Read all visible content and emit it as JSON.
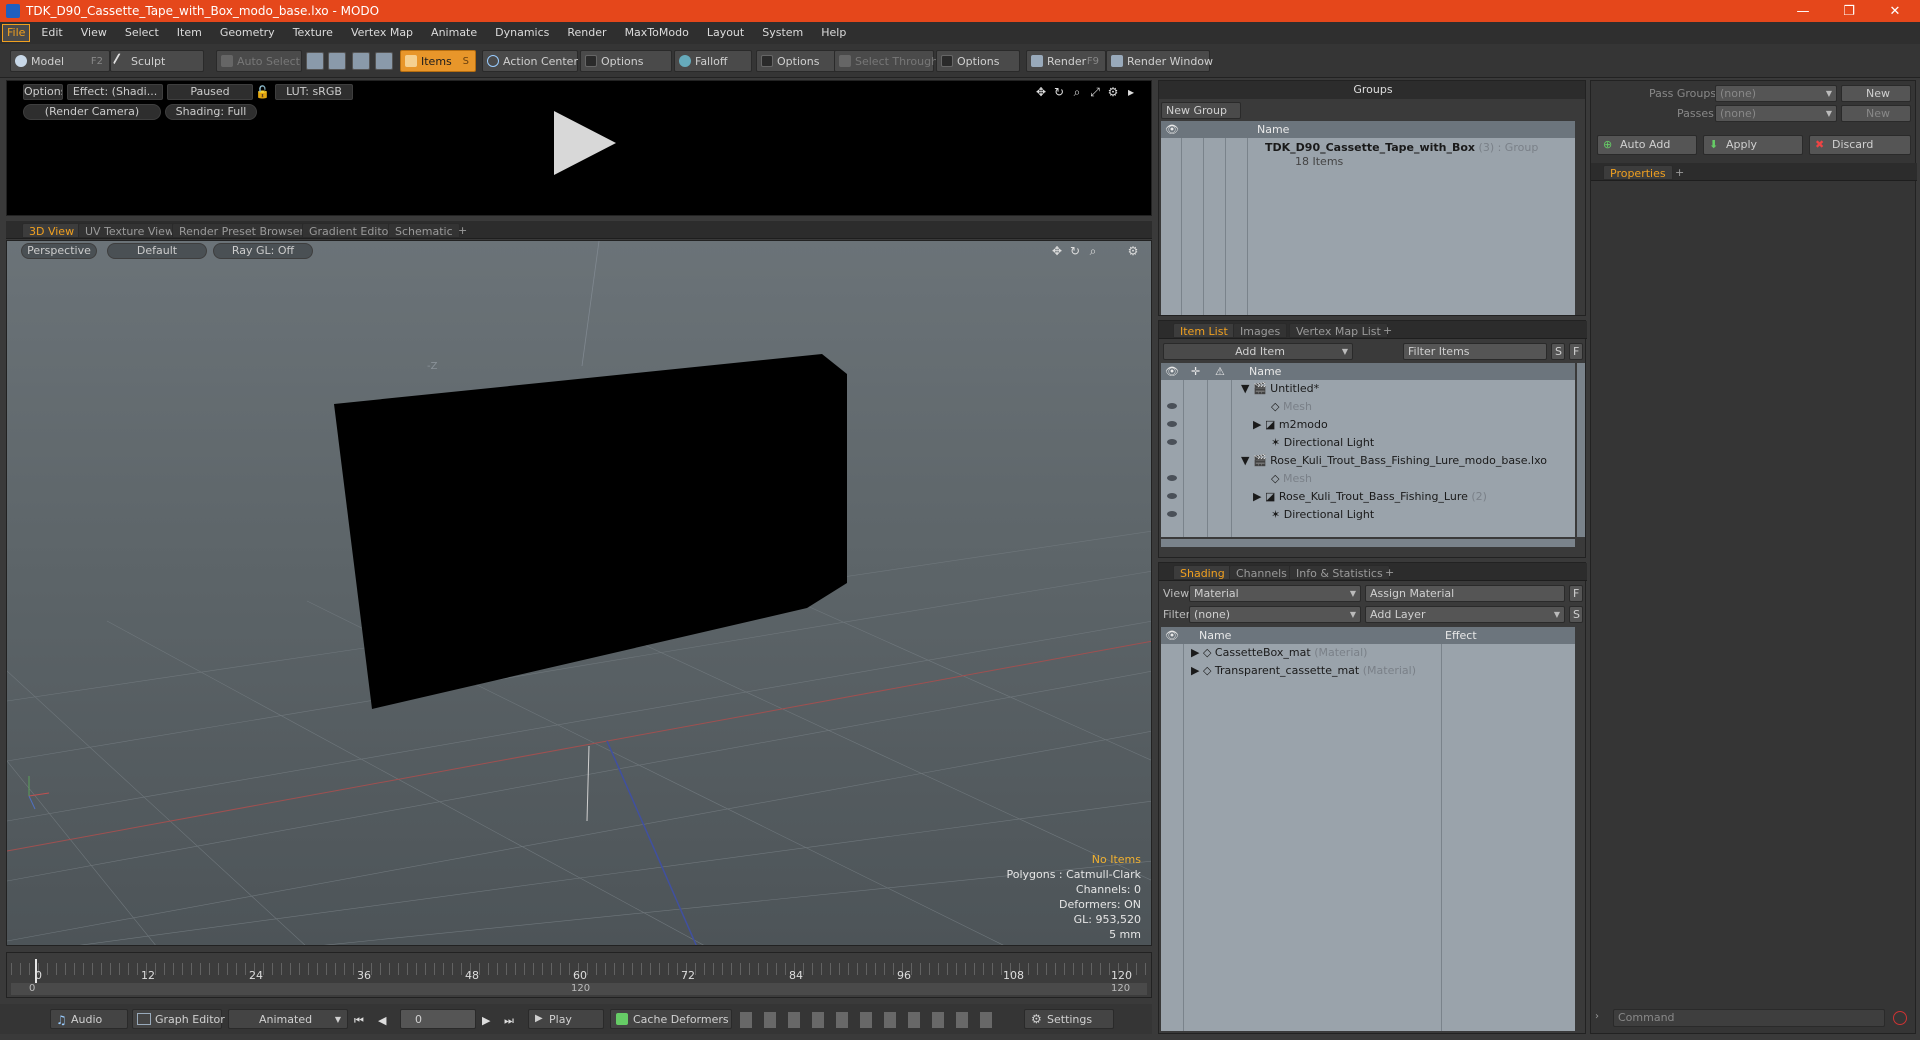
{
  "window": {
    "title": "TDK_D90_Cassette_Tape_with_Box_modo_base.lxo - MODO",
    "controls": [
      "—",
      "❐",
      "✕"
    ]
  },
  "menu": [
    "File",
    "Edit",
    "View",
    "Select",
    "Item",
    "Geometry",
    "Texture",
    "Vertex Map",
    "Animate",
    "Dynamics",
    "Render",
    "MaxToModo",
    "Layout",
    "System",
    "Help"
  ],
  "toolbar": {
    "model": "Model",
    "model_key": "F2",
    "sculpt": "Sculpt",
    "auto_select": "Auto Select",
    "items": "Items",
    "items_key": "S",
    "action_center": "Action Center",
    "options1": "Options",
    "falloff": "Falloff",
    "options2": "Options",
    "select_through": "Select Through",
    "options3": "Options",
    "render": "Render",
    "render_key": "F9",
    "render_window": "Render Window"
  },
  "preview": {
    "options": "Options",
    "effect": "Effect: (Shadi...",
    "paused": "Paused",
    "lut": "LUT: sRGB",
    "camera": "(Render Camera)",
    "shading": "Shading: Full"
  },
  "viewport_tabs": [
    "3D View",
    "UV Texture View",
    "Render Preset Browser",
    "Gradient Editor",
    "Schematic",
    "+"
  ],
  "viewport": {
    "perspective": "Perspective",
    "default": "Default",
    "raygl": "Ray GL: Off",
    "axis_label": "-Z",
    "info": {
      "no_items": "No Items",
      "polygons": "Polygons : Catmull-Clark",
      "channels": "Channels: 0",
      "deformers": "Deformers: ON",
      "gl": "GL: 953,520",
      "unit": "5 mm"
    }
  },
  "timeline": {
    "ticks": [
      "0",
      "12",
      "24",
      "36",
      "48",
      "60",
      "72",
      "84",
      "96",
      "108",
      "120"
    ],
    "lower_left": "0",
    "lower_mid": "120",
    "lower_right": "120"
  },
  "bottom": {
    "audio": "Audio",
    "graph_editor": "Graph Editor",
    "animated": "Animated",
    "frame": "0",
    "play": "Play",
    "cache_deformers": "Cache Deformers",
    "settings": "Settings"
  },
  "groups": {
    "title": "Groups",
    "new_group": "New Group",
    "col_name": "Name",
    "item_name": "TDK_D90_Cassette_Tape_with_Box",
    "item_suffix": "(3) : Group",
    "item_count": "18 Items"
  },
  "item_list": {
    "tabs": [
      "Item List",
      "Images",
      "Vertex Map List",
      "+"
    ],
    "add_item": "Add Item",
    "filter": "Filter Items",
    "s": "S",
    "f": "F",
    "col_name": "Name",
    "rows": [
      {
        "label": "Untitled*",
        "suffix": ""
      },
      {
        "label": "Mesh",
        "suffix": ""
      },
      {
        "label": "m2modo",
        "suffix": ""
      },
      {
        "label": "Directional Light",
        "suffix": ""
      },
      {
        "label": "Rose_Kuli_Trout_Bass_Fishing_Lure_modo_base.lxo",
        "suffix": ""
      },
      {
        "label": "Mesh",
        "suffix": ""
      },
      {
        "label": "Rose_Kuli_Trout_Bass_Fishing_Lure",
        "suffix": "(2)"
      },
      {
        "label": "Directional Light",
        "suffix": ""
      }
    ]
  },
  "shading": {
    "tabs": [
      "Shading",
      "Channels",
      "Info & Statistics",
      "+"
    ],
    "view_label": "View",
    "view_value": "Material",
    "assign_material": "Assign Material",
    "filter_label": "Filter",
    "filter_value": "(none)",
    "add_layer": "Add Layer",
    "f": "F",
    "s": "S",
    "col_name": "Name",
    "col_effect": "Effect",
    "rows": [
      {
        "label": "CassetteBox_mat",
        "suffix": "(Material)"
      },
      {
        "label": "Transparent_cassette_mat",
        "suffix": "(Material)"
      }
    ]
  },
  "properties": {
    "pass_groups_label": "Pass Groups",
    "pass_groups_value": "(none)",
    "new1": "New",
    "passes_label": "Passes",
    "passes_value": "(none)",
    "new2": "New",
    "auto_add": "Auto Add",
    "apply": "Apply",
    "discard": "Discard",
    "tab": "Properties",
    "plus": "+",
    "command_placeholder": "Command"
  }
}
